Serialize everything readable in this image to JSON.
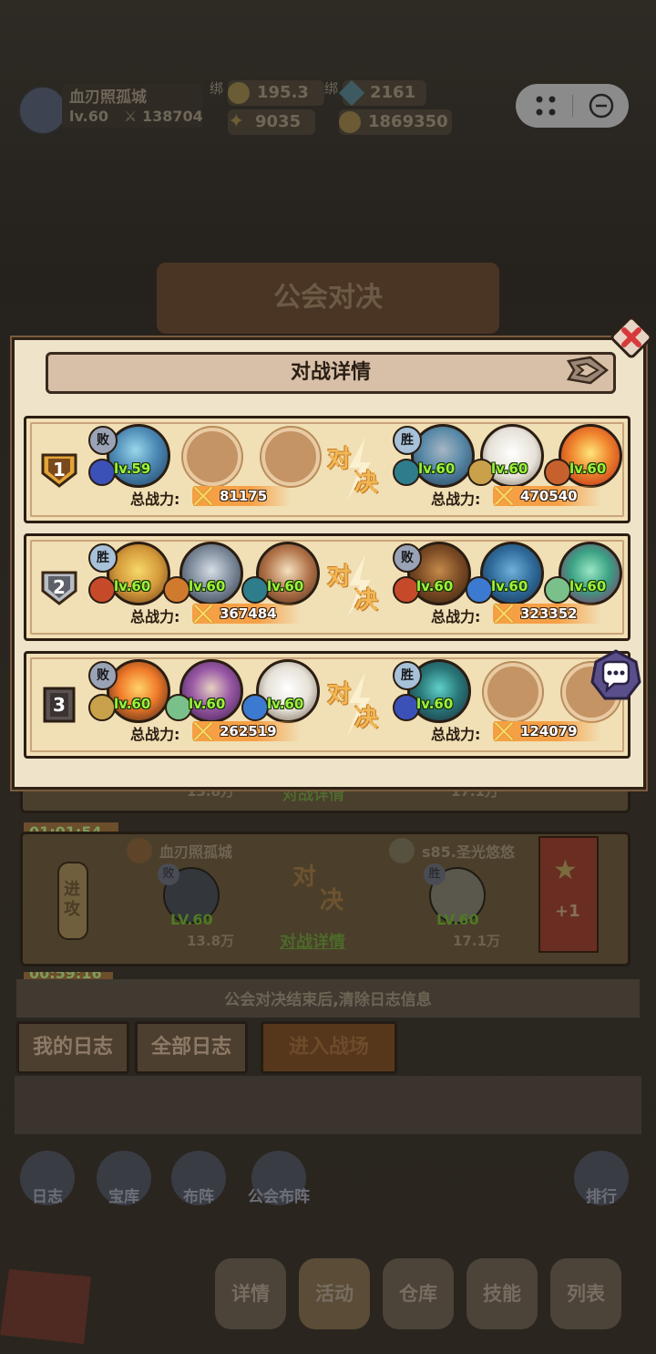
{
  "hud": {
    "player_name": "血刃照孤城",
    "level": "lv.60",
    "power": "138704",
    "bound_label": "绑",
    "gold_bound": "195.3万",
    "gem_bound": "2161",
    "stars": "9035",
    "coins": "1869350"
  },
  "page_title": "公会对决",
  "modal": {
    "title": "对战详情",
    "vs_text_1": "对",
    "vs_text_2": "决",
    "power_label": "总战力:",
    "result_win": "胜",
    "result_lose": "败",
    "matches": [
      {
        "rank": "1",
        "left": {
          "result": "败",
          "power": "81175",
          "heroes": [
            {
              "level": "lv.59"
            }
          ]
        },
        "right": {
          "result": "胜",
          "power": "470540",
          "heroes": [
            {
              "level": "lv.60"
            },
            {
              "level": "lv.60"
            },
            {
              "level": "lv.60"
            }
          ]
        }
      },
      {
        "rank": "2",
        "left": {
          "result": "胜",
          "power": "367484",
          "heroes": [
            {
              "level": "lv.60"
            },
            {
              "level": "lv.60"
            },
            {
              "level": "lv.60"
            }
          ]
        },
        "right": {
          "result": "败",
          "power": "323352",
          "heroes": [
            {
              "level": "lv.60"
            },
            {
              "level": "lv.60"
            },
            {
              "level": "lv.60"
            }
          ]
        }
      },
      {
        "rank": "3",
        "left": {
          "result": "败",
          "power": "262519",
          "heroes": [
            {
              "level": "lv.60"
            },
            {
              "level": "lv.60"
            },
            {
              "level": "lv.60"
            }
          ]
        },
        "right": {
          "result": "胜",
          "power": "124079",
          "heroes": [
            {
              "level": "lv.60"
            }
          ]
        }
      }
    ]
  },
  "log": {
    "partial_power_left": "13.8万",
    "partial_power_right": "17.1万",
    "partial_detail": "对战详情",
    "entry": {
      "timer": "01:01:54",
      "action": "进攻",
      "left_name": "血刃照孤城",
      "right_name": "s85.圣光悠悠",
      "left_result": "败",
      "right_result": "胜",
      "left_level": "LV.60",
      "right_level": "LV.60",
      "left_power": "13.8万",
      "right_power": "17.1万",
      "vs_1": "对",
      "vs_2": "决",
      "detail_link": "对战详情",
      "reward": "+1"
    },
    "partial_timer": "00:59:16",
    "notice": "公会对决结束后,清除日志信息"
  },
  "tabs": {
    "my_log": "我的日志",
    "all_log": "全部日志",
    "enter": "进入战场"
  },
  "nav_icons": {
    "log": "日志",
    "vault": "宝库",
    "formation": "布阵",
    "guild_formation": "公会布阵",
    "ranking": "排行"
  },
  "bottom_nav": {
    "details": "详情",
    "activity": "活动",
    "warehouse": "仓库",
    "skills": "技能",
    "list": "列表"
  }
}
